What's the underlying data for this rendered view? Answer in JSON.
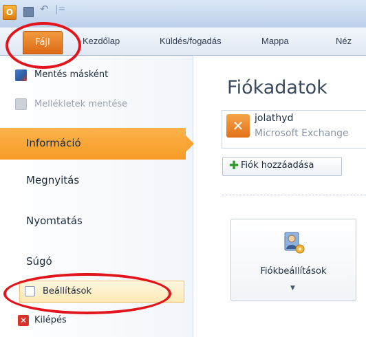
{
  "quick_access": {
    "app_icon_letter": "O",
    "undo_glyph": "↶",
    "separator_glyph": "|="
  },
  "ribbon": {
    "file_tab": "Fájl",
    "tabs": [
      "Kezdőlap",
      "Küldés/fogadás",
      "Mappa",
      "Néz"
    ]
  },
  "backstage": {
    "commands": [
      {
        "label": "Mentés másként",
        "enabled": true,
        "icon": "save-as-icon"
      },
      {
        "label": "Mellékletek mentése",
        "enabled": false,
        "icon": "save-attachments-icon"
      }
    ],
    "nav": [
      {
        "label": "Információ",
        "selected": true
      },
      {
        "label": "Megnyitás",
        "selected": false
      },
      {
        "label": "Nyomtatás",
        "selected": false
      },
      {
        "label": "Súgó",
        "selected": false
      }
    ],
    "settings_label": "Beállítások",
    "exit_label": "Kilépés"
  },
  "content": {
    "title": "Fiókadatok",
    "account": {
      "name": "jolathyd",
      "type": "Microsoft Exchange"
    },
    "add_account_label": "Fiók hozzáadása",
    "account_settings_label": "Fiókbeállítások",
    "dropdown_glyph": "▼"
  },
  "colors": {
    "file_tab": "#e0701a",
    "selected_nav": "#f8a434",
    "annotation_ring": "#e2141c"
  }
}
